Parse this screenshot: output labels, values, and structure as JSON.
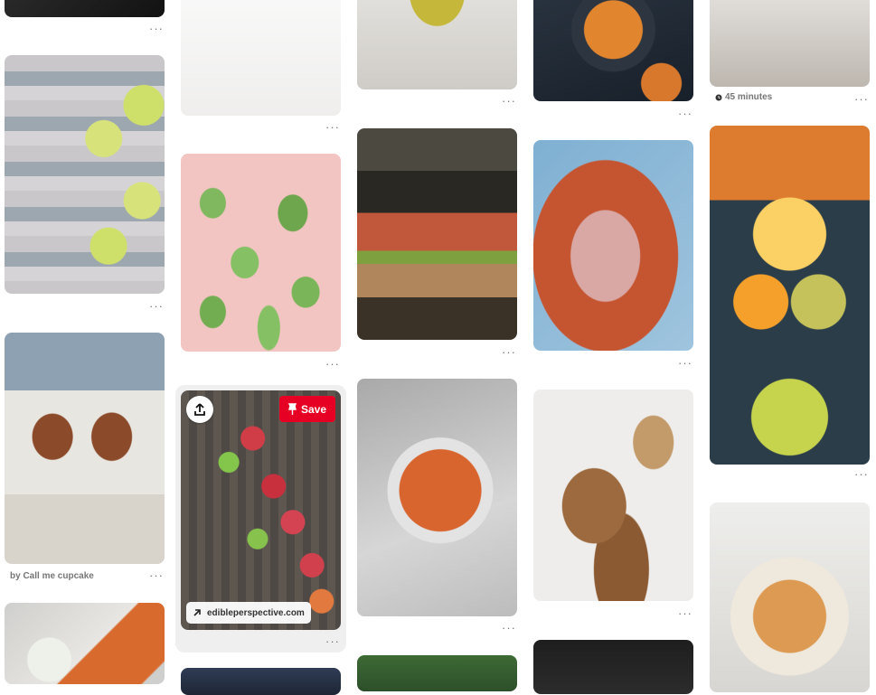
{
  "colors": {
    "save_bg": "#e60023",
    "meta_text": "#767676",
    "hover_card_bg": "#efefef"
  },
  "more_label": "···",
  "hovered_pin": {
    "save_label": "Save",
    "save_icon": "pin-icon",
    "share_icon": "upload-icon",
    "link_icon": "arrow-up-right-icon",
    "link_text": "edibleperspective.com"
  },
  "captions": {
    "burger_attribution": "by Call me cupcake",
    "scallop_time": "45 minutes",
    "time_icon": "clock-icon"
  },
  "pins": [
    {
      "id": "dark-top",
      "subject": "dark dish"
    },
    {
      "id": "sardines",
      "subject": "sardines with lime slices"
    },
    {
      "id": "burgers",
      "subject": "burgers on a board"
    },
    {
      "id": "sweet-potato-fries",
      "subject": "sweet potato fries with dip"
    },
    {
      "id": "sprouts",
      "subject": "microgreens on white"
    },
    {
      "id": "cucumbers",
      "subject": "cucumbers on pink background"
    },
    {
      "id": "blood-oranges",
      "subject": "blood oranges and limes"
    },
    {
      "id": "blueberries",
      "subject": "dark blue"
    },
    {
      "id": "smoothie",
      "subject": "yellow smoothie"
    },
    {
      "id": "sandwich",
      "subject": "club sandwich"
    },
    {
      "id": "spaghetti",
      "subject": "spaghetti in tomato sauce"
    },
    {
      "id": "greens",
      "subject": "leafy greens"
    },
    {
      "id": "soup",
      "subject": "orange soup"
    },
    {
      "id": "prosciutto-pizza",
      "subject": "prosciutto pizza"
    },
    {
      "id": "banana-toast",
      "subject": "banana toast"
    },
    {
      "id": "dark-bottom",
      "subject": "dark pot"
    },
    {
      "id": "chopsticks",
      "subject": "bowl with chopsticks"
    },
    {
      "id": "fruit-halves",
      "subject": "fruit cross sections"
    },
    {
      "id": "scallops",
      "subject": "scallops with kale"
    }
  ]
}
